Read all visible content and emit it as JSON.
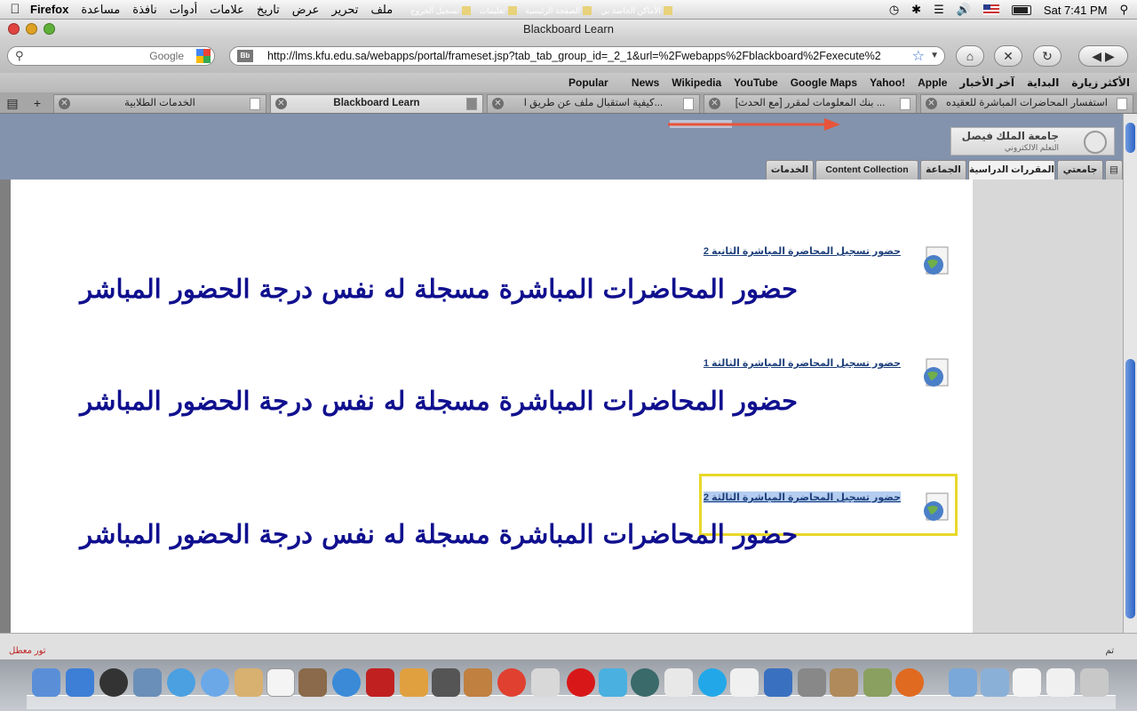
{
  "menubar": {
    "app": "Firefox",
    "menus": [
      "ملف",
      "تحرير",
      "عرض",
      "تاريخ",
      "علامات",
      "أدوات",
      "نافذة",
      "مساعدة"
    ],
    "clock": "Sat 7:41 PM"
  },
  "window": {
    "title": "Blackboard Learn"
  },
  "toolbar": {
    "search_placeholder": "Google",
    "url": "http://lms.kfu.edu.sa/webapps/portal/frameset.jsp?tab_tab_group_id=_2_1&url=%2Fwebapps%2Fblackboard%2Fexecute%2",
    "bb_badge": "Bb"
  },
  "bookmarks": [
    "Popular",
    "News",
    "Wikipedia",
    "YouTube",
    "Google Maps",
    "Yahoo!",
    "Apple",
    "آخر الأخبار",
    "البداية",
    "الأكثر زيارة"
  ],
  "tabs": [
    {
      "label": "الخدمات الطلابية",
      "active": false
    },
    {
      "label": "Blackboard Learn",
      "active": true
    },
    {
      "label": "كيفية استقبال ملف عن طريق ا...",
      "active": false
    },
    {
      "label": "[مع الحدث] بنك المعلومات لمقرر ...",
      "active": false
    },
    {
      "label": "استفسار المحاضرات المباشرة للعقيده",
      "active": false
    }
  ],
  "bb": {
    "top_links": [
      "الأماكن الخاصة بي",
      "الصفحة الرئيسية",
      "تعليمات",
      "تسجيل الخروج"
    ],
    "logo_line1": "جامعة الملك فيصل",
    "logo_line2": "التعلم الالكتروني",
    "nav_tabs": [
      "جامعتي",
      "المقررات الدراسية",
      "الجماعة",
      "Content Collection",
      "الخدمات"
    ]
  },
  "content": {
    "items": [
      {
        "link": "حضور تسجيل المحاضرة المباشرة الثانية 2",
        "text": "حضور المحاضرات المباشرة مسجلة له نفس درجة الحضور المباشر"
      },
      {
        "link": "حضور تسجيل المحاضرة المباشرة الثالثة 1",
        "text": "حضور المحاضرات المباشرة مسجلة له نفس درجة الحضور المباشر"
      },
      {
        "link": "حضور تسجيل المحاضرة المباشرة الثالثة 2",
        "text": "حضور المحاضرات المباشرة مسجلة له نفس درجة الحضور المباشر"
      }
    ]
  },
  "status": {
    "left": "تور معطل",
    "right": "تم"
  },
  "colors": {
    "bb_header": "#8393ad",
    "link": "#1d3f7a",
    "big_text": "#10108f",
    "highlight_box": "#e8d82a"
  }
}
